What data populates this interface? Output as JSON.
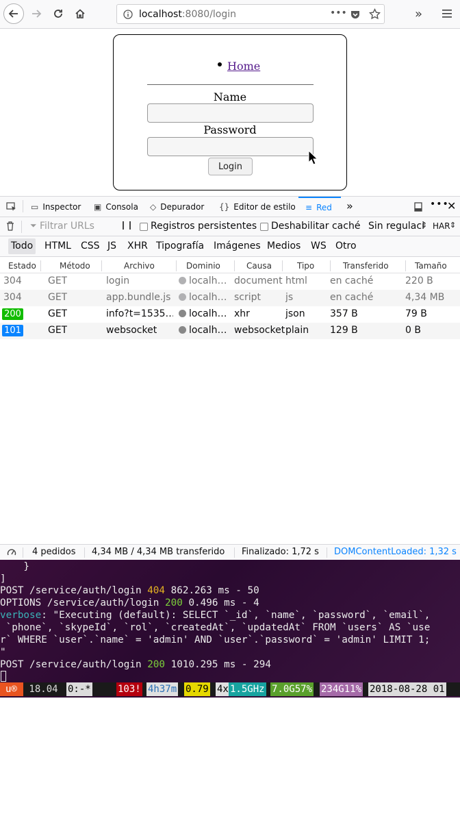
{
  "browser": {
    "url_host": "localhost",
    "url_rest": ":8080/login",
    "more_dots": "•••"
  },
  "page": {
    "nav_home": "Home",
    "name_label": "Name",
    "password_label": "Password",
    "login_button": "Login"
  },
  "devtools": {
    "tabs": [
      "Inspector",
      "Consola",
      "Depurador",
      "Editor de estilo",
      "Red"
    ],
    "filter_placeholder": "Filtrar URLs",
    "pause_label": "❙❙",
    "persist_logs": "Registros persistentes",
    "disable_cache": "Deshabilitar caché",
    "throttle": "Sin regulaci",
    "har": "HAR",
    "types": [
      "Todo",
      "HTML",
      "CSS",
      "JS",
      "XHR",
      "Tipografía",
      "Imágenes",
      "Medios",
      "WS",
      "Otro"
    ],
    "columns": [
      "Estado",
      "Método",
      "Archivo",
      "Dominio",
      "Causa",
      "Tipo",
      "Transferido",
      "Tamaño"
    ],
    "requests": [
      {
        "status": "304",
        "method": "GET",
        "file": "login",
        "domain": "localh…",
        "cause": "document",
        "type": "html",
        "transferred": "en caché",
        "size": "220 B"
      },
      {
        "status": "304",
        "method": "GET",
        "file": "app.bundle.js",
        "domain": "localh…",
        "cause": "script",
        "type": "js",
        "transferred": "en caché",
        "size": "4,34 MB"
      },
      {
        "status": "200",
        "method": "GET",
        "file": "info?t=1535…",
        "domain": "localh…",
        "cause": "xhr",
        "type": "json",
        "transferred": "357 B",
        "size": "79 B"
      },
      {
        "status": "101",
        "method": "GET",
        "file": "websocket",
        "domain": "localh…",
        "cause": "websocket",
        "type": "plain",
        "transferred": "129 B",
        "size": "0 B"
      }
    ],
    "status_bar": {
      "requests": "4 pedidos",
      "transferred": "4,34 MB / 4,34 MB transferido",
      "finished": "Finalizado: 1,72 s",
      "dom_loaded": "DOMContentLoaded: 1,32 s"
    },
    "colors": {
      "accent": "#0a84ff",
      "status_200": "#12bc00",
      "status_101": "#0a84ff"
    }
  },
  "terminal": {
    "lines": [
      {
        "text": "    }"
      },
      {
        "text": "]"
      },
      {
        "pre": "POST /service/auth/login ",
        "code": "404",
        "code_color": "yellow",
        "post": " 862.263 ms - 50"
      },
      {
        "pre": "OPTIONS /service/auth/login ",
        "code": "200",
        "code_color": "green",
        "post": " 0.496 ms - 4"
      },
      {
        "verbose": "verbose",
        "post": ": \"Executing (default): SELECT `_id`, `name`, `password`, `email`,"
      },
      {
        "text": " `phone`, `skypeId`, `rol`, `createdAt`, `updatedAt` FROM `users` AS `use"
      },
      {
        "text": "r` WHERE `user`.`name` = 'admin' AND `user`.`password` = 'admin' LIMIT 1;"
      },
      {
        "text": "\""
      },
      {
        "pre": "POST /service/auth/login ",
        "code": "200",
        "code_color": "green",
        "post": " 1010.295 ms - 294"
      }
    ],
    "tmux": [
      "u®",
      " 18.04 ",
      "0:-*",
      "103!",
      "4h37m",
      "0.79",
      "4x",
      "1.5GHz",
      "7.0G57%",
      "234G11%",
      "2018-08-28 01"
    ]
  }
}
